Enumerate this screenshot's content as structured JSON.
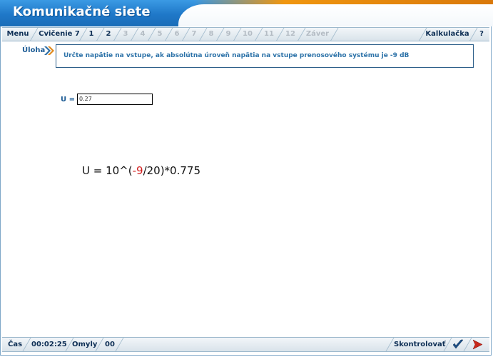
{
  "app": {
    "title": "Komunikačné siete"
  },
  "tabs": {
    "menu": "Menu",
    "exercise": "Cvičenie 7",
    "pages": [
      "1",
      "2",
      "3",
      "4",
      "5",
      "6",
      "7",
      "8",
      "9",
      "10",
      "11",
      "12"
    ],
    "active_pages": [
      "1",
      "2"
    ],
    "end": "Záver",
    "calculator": "Kalkulačka",
    "help": "?"
  },
  "task": {
    "label": "Úloha",
    "text": "Určte napätie na vstupe, ak absolútna úroveň napätia na vstupe prenosového systému je -9 dB"
  },
  "answer": {
    "label": "U =",
    "value": "0.27"
  },
  "formula": {
    "prefix": "U = 10^(",
    "negative": "-9",
    "suffix": "/20)*0.775"
  },
  "status": {
    "time_label": "Čas",
    "time_value": "00:02:25",
    "errors_label": "Omyly",
    "errors_value": "00",
    "check_label": "Skontrolovať"
  },
  "colors": {
    "header_blue": "#1f78c8",
    "accent_orange": "#f0960f",
    "text_blue": "#2c72a8",
    "formula_red": "#d21f1f"
  }
}
